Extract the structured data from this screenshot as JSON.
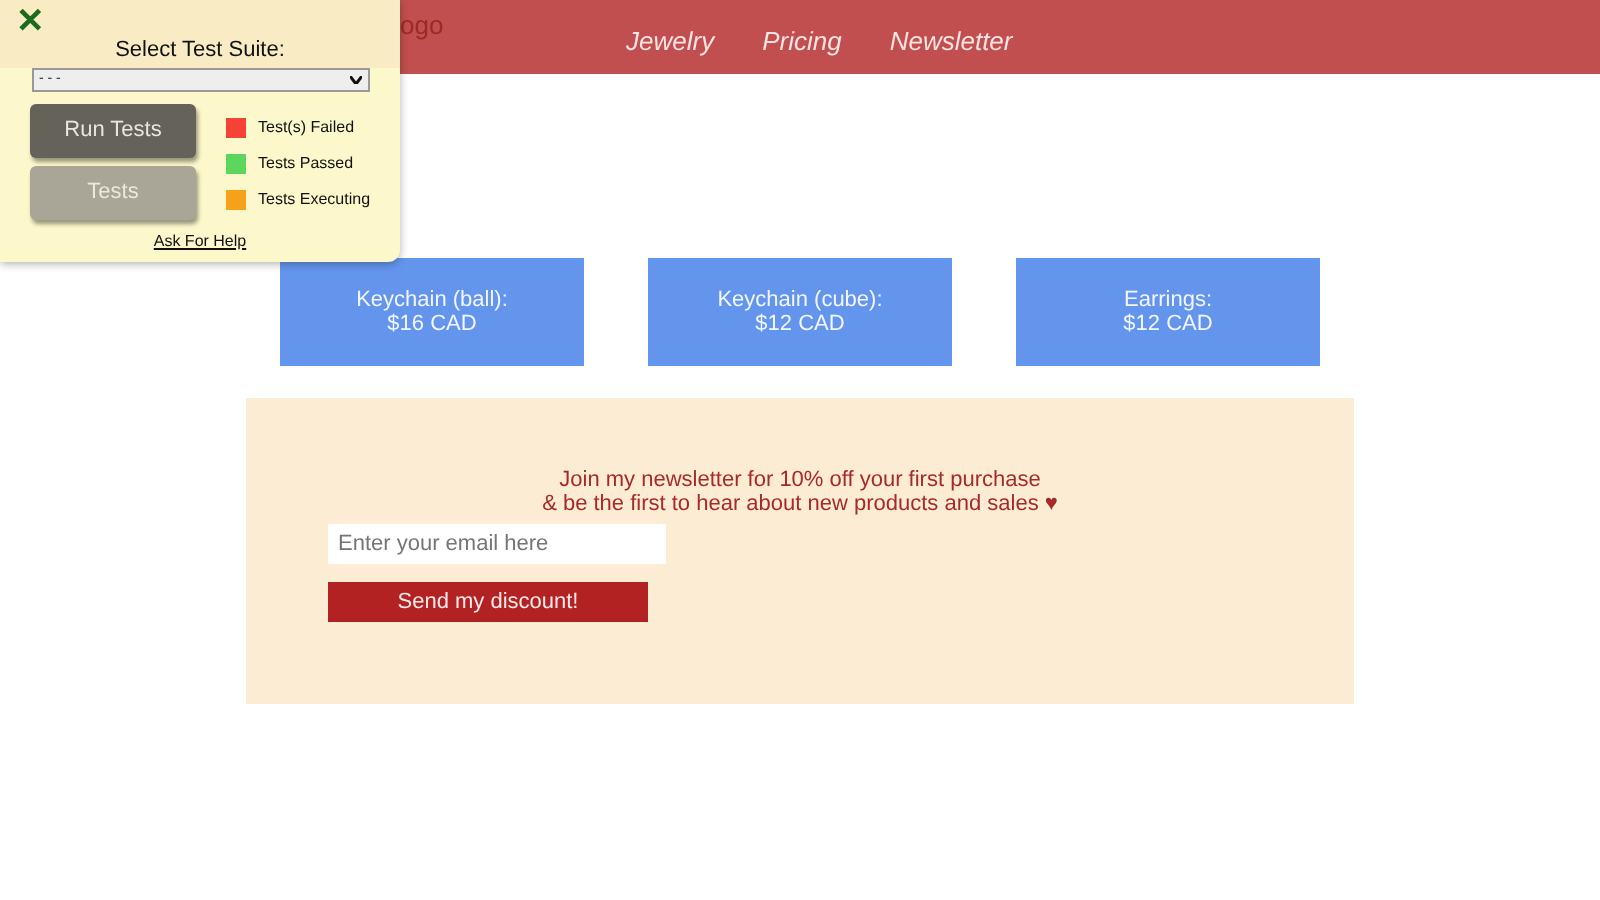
{
  "navbar": {
    "logo_visible": "ogo",
    "links": [
      "Jewelry",
      "Pricing",
      "Newsletter"
    ]
  },
  "test_panel": {
    "close": "✕",
    "title": "Select Test Suite:",
    "suite_select": {
      "value": "- - -"
    },
    "buttons": [
      {
        "label": "Run Tests",
        "disabled": false
      },
      {
        "label": "Tests",
        "disabled": true
      }
    ],
    "legend": [
      {
        "label": "Test(s) Failed",
        "color": "#f44336"
      },
      {
        "label": "Tests Passed",
        "color": "#5cd65c"
      },
      {
        "label": "Tests Executing",
        "color": "#f5a11b"
      }
    ],
    "help_link": "Ask For Help"
  },
  "products": [
    {
      "name": "Keychain (ball):",
      "price": "$16 CAD"
    },
    {
      "name": "Keychain (cube):",
      "price": "$12 CAD"
    },
    {
      "name": "Earrings:",
      "price": "$12 CAD"
    }
  ],
  "newsletter": {
    "lines": [
      "Join my newsletter for 10% off your first purchase",
      "& be the first to hear about new products and sales ♥"
    ],
    "email": {
      "placeholder": "Enter your email here"
    },
    "submit": "Send my discount!"
  }
}
